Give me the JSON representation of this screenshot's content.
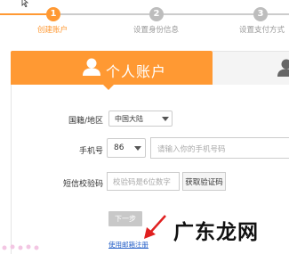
{
  "steps": [
    {
      "num": "1",
      "label": "创建账户"
    },
    {
      "num": "2",
      "label": "设置身份信息"
    },
    {
      "num": "3",
      "label": "设置支付方式"
    }
  ],
  "tabs": {
    "personal": "个人账户"
  },
  "form": {
    "region": {
      "label": "国籍/地区",
      "value": "中国大陆"
    },
    "phone": {
      "label": "手机号",
      "code": "86",
      "placeholder": "请输入你的手机号码"
    },
    "sms": {
      "label": "短信校验码",
      "placeholder": "校验码是6位数字",
      "button": "获取验证码"
    },
    "next": "下一步",
    "email_link": "使用邮箱注册"
  },
  "watermark": "广东龙网",
  "colors": {
    "accent": "#ff9933",
    "inactive": "#c8c8c8",
    "link": "#2a63c9",
    "arrow": "#e02020"
  }
}
